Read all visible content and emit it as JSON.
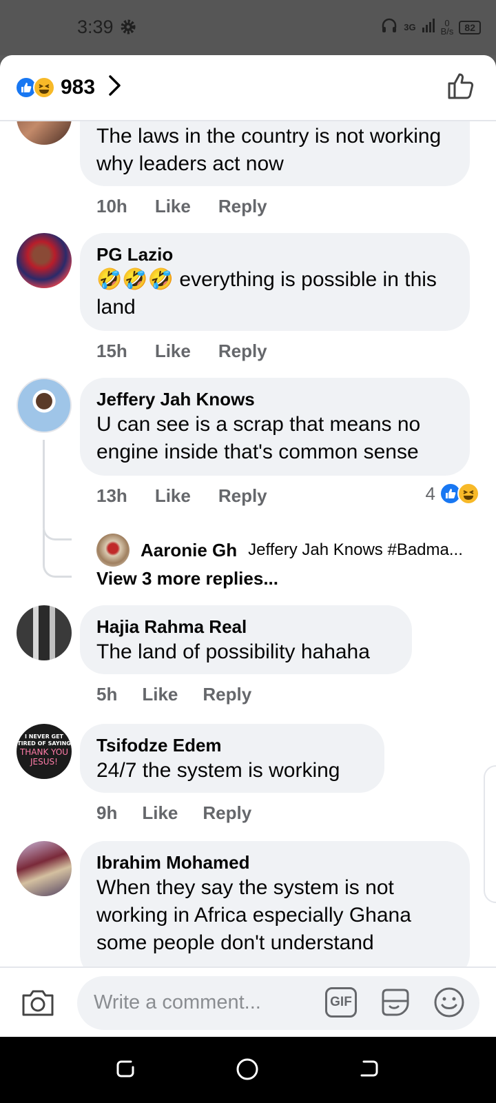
{
  "status_bar": {
    "time": "3:39",
    "network": "3G",
    "speed_value": "0",
    "speed_unit": "B/s",
    "battery": "82"
  },
  "header": {
    "reaction_count": "983"
  },
  "comments": [
    {
      "name": "",
      "text": "The laws in the country is not working why leaders act now",
      "time": "10h",
      "like": "Like",
      "reply": "Reply"
    },
    {
      "name": "PG Lazio",
      "emojis": "🤣🤣🤣",
      "text": " everything is possible in this land",
      "time": "15h",
      "like": "Like",
      "reply": "Reply"
    },
    {
      "name": "Jeffery Jah Knows",
      "text": "U can see is a scrap that means no engine inside that's common sense",
      "time": "13h",
      "like": "Like",
      "reply": "Reply",
      "reactions": "4",
      "reply_preview": {
        "name": "Aaronie Gh",
        "text": "Jeffery Jah Knows #Badma..."
      },
      "view_more": "View 3 more replies..."
    },
    {
      "name": "Hajia Rahma Real",
      "text": "The land of possibility hahaha",
      "time": "5h",
      "like": "Like",
      "reply": "Reply"
    },
    {
      "name": "Tsifodze Edem",
      "text": "24/7 the system is working",
      "time": "9h",
      "like": "Like",
      "reply": "Reply",
      "avatar_text": [
        "I NEVER GET",
        "TIRED OF SAYING",
        "THANK YOU",
        "JESUS!"
      ]
    },
    {
      "name": "Ibrahim Mohamed",
      "text": "When they say the system is not working in  Africa  especially Ghana some people don't understand"
    }
  ],
  "composer": {
    "placeholder": "Write a comment...",
    "gif_label": "GIF"
  }
}
